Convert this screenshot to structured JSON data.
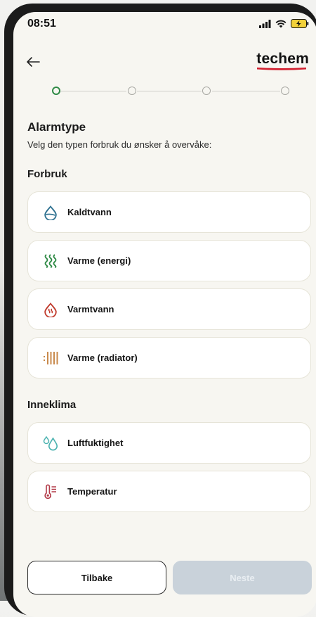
{
  "status_bar": {
    "time": "08:51"
  },
  "header": {
    "logo_text": "techem",
    "brand_red": "#d2202f"
  },
  "stepper": {
    "total_steps": 4,
    "current_step": 1,
    "active_color": "#2f8a46"
  },
  "page": {
    "title": "Alarmtype",
    "subtitle": "Velg den typen forbruk du ønsker å overvåke:"
  },
  "forbruk": {
    "heading": "Forbruk",
    "items": [
      {
        "label": "Kaldtvann",
        "icon": "water-drop-icon"
      },
      {
        "label": "Varme (energi)",
        "icon": "heat-waves-icon"
      },
      {
        "label": "Varmtvann",
        "icon": "hot-water-drop-icon"
      },
      {
        "label": "Varme (radiator)",
        "icon": "radiator-icon"
      }
    ]
  },
  "inneklima": {
    "heading": "Inneklima",
    "items": [
      {
        "label": "Luftfuktighet",
        "icon": "humidity-drops-icon"
      },
      {
        "label": "Temperatur",
        "icon": "thermometer-icon"
      }
    ]
  },
  "footer": {
    "back_label": "Tilbake",
    "next_label": "Neste",
    "next_disabled": true
  }
}
